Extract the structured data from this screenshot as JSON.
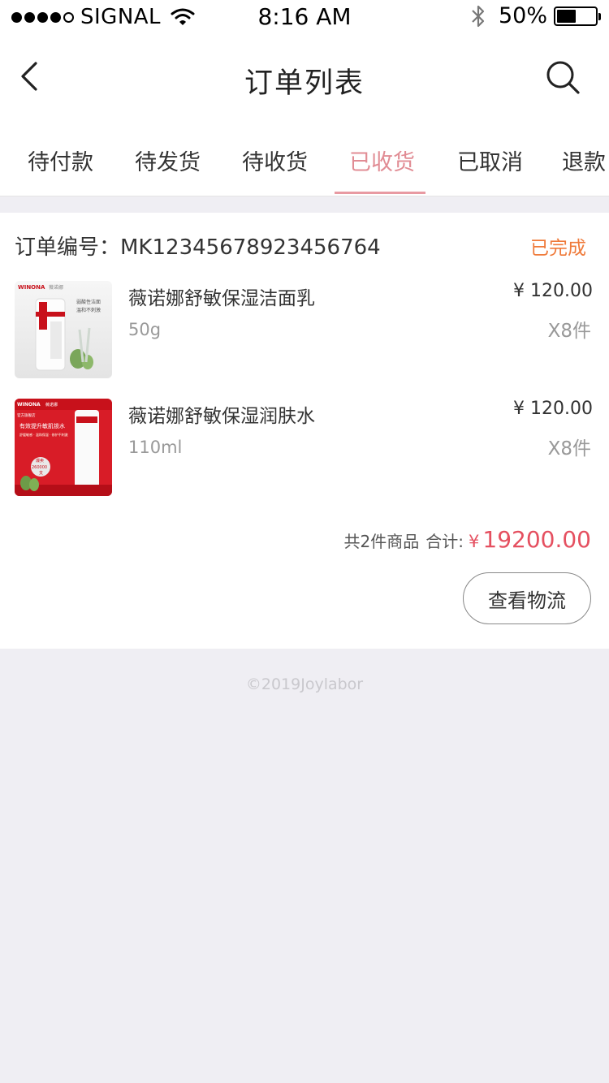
{
  "status_bar": {
    "carrier": "SIGNAL",
    "time": "8:16 AM",
    "battery_percent": "50%",
    "battery_level": 0.5,
    "icons": [
      "signal-dots-icon",
      "wifi-icon",
      "bluetooth-icon",
      "battery-icon"
    ]
  },
  "nav": {
    "title": "订单列表",
    "back_icon": "chevron-left-icon",
    "search_icon": "search-icon"
  },
  "tabs": [
    {
      "label": "待付款",
      "active": false
    },
    {
      "label": "待发货",
      "active": false
    },
    {
      "label": "待收货",
      "active": false
    },
    {
      "label": "已收货",
      "active": true
    },
    {
      "label": "已取消",
      "active": false
    },
    {
      "label": "退款",
      "active": false
    }
  ],
  "order": {
    "number_text": "订单编号：MK12345678923456764",
    "status": "已完成",
    "products": [
      {
        "name": "薇诺娜舒敏保湿洁面乳",
        "spec": "50g",
        "price": "¥ 120.00",
        "qty": "X8件",
        "image_text": [
          "WINONA",
          "薇诺娜",
          "弱酸性洁面",
          "温和不刺激"
        ]
      },
      {
        "name": "薇诺娜舒敏保湿润肤水",
        "spec": "110ml",
        "price": "¥ 120.00",
        "qty": "X8件",
        "image_text": [
          "WINONA",
          "薇诺娜",
          "官方旗舰店",
          "有效提升敏肌锁水",
          "舒缓敏感 · 温和保湿 · 修护不刺激",
          "爆卖",
          "260000",
          "支"
        ]
      }
    ],
    "summary_count": "共2件商品",
    "summary_label": "合计:",
    "currency": "¥",
    "total": "19200.00",
    "button_label": "查看物流"
  },
  "footer": "©2019Joylabor",
  "colors": {
    "accent_pink": "#e18c94",
    "status_orange": "#ef7a3a",
    "price_red": "#e55060",
    "background": "#efeef3"
  }
}
